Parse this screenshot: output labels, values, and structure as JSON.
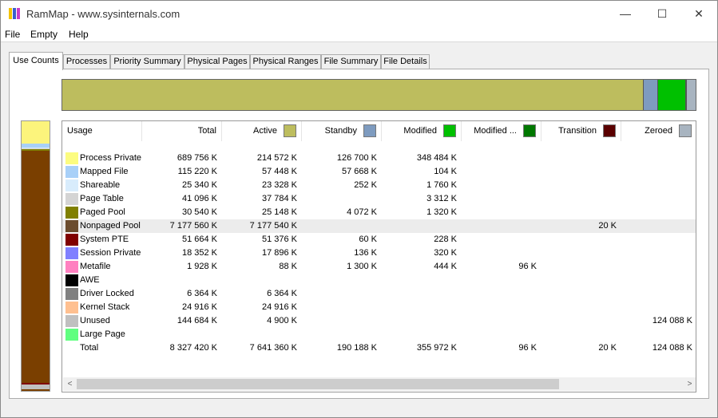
{
  "window": {
    "title": "RamMap - www.sysinternals.com",
    "icon_name": "rammap-app-icon",
    "icon_colors": [
      "#f2c200",
      "#3a5fcd",
      "#c83cc8"
    ],
    "minimize": "—",
    "maximize": "☐",
    "close": "✕"
  },
  "menu": [
    "File",
    "Empty",
    "Help"
  ],
  "tabs": [
    "Use Counts",
    "Processes",
    "Priority Summary",
    "Physical Pages",
    "Physical Ranges",
    "File Summary",
    "File Details"
  ],
  "active_tab": "Use Counts",
  "top_bar": [
    {
      "name": "Active",
      "color": "#bdbd5e",
      "fraction": 0.917
    },
    {
      "name": "Standby",
      "color": "#7e9bbf",
      "fraction": 0.023
    },
    {
      "name": "Modified",
      "color": "#00c000",
      "fraction": 0.043
    },
    {
      "name": "Modified no write",
      "color": "#007800",
      "fraction": 0.002
    },
    {
      "name": "Zeroed",
      "color": "#a8b4c0",
      "fraction": 0.015
    }
  ],
  "left_bar": [
    {
      "name": "Process Private",
      "color": "#fcf47c",
      "fraction": 0.083
    },
    {
      "name": "Mapped File",
      "color": "#a8d0f8",
      "fraction": 0.014
    },
    {
      "name": "Shareable",
      "color": "#d8ecfc",
      "fraction": 0.003
    },
    {
      "name": "Page Table",
      "color": "#d0d0d0",
      "fraction": 0.005
    },
    {
      "name": "Paged Pool",
      "color": "#808000",
      "fraction": 0.004
    },
    {
      "name": "Nonpaged Pool",
      "color": "#7a3f00",
      "fraction": 0.862
    },
    {
      "name": "System PTE",
      "color": "#800000",
      "fraction": 0.006
    },
    {
      "name": "Unused",
      "color": "#c0c0c0",
      "fraction": 0.017
    }
  ],
  "columns": [
    {
      "label": "Usage",
      "swatch": null
    },
    {
      "label": "Total",
      "swatch": null
    },
    {
      "label": "Active",
      "swatch": "#bdbd5e"
    },
    {
      "label": "Standby",
      "swatch": "#7e9bbf"
    },
    {
      "label": "Modified",
      "swatch": "#00c000"
    },
    {
      "label": "Modified ...",
      "swatch": "#007800"
    },
    {
      "label": "Transition",
      "swatch": "#5a0000"
    },
    {
      "label": "Zeroed",
      "swatch": "#a8b4c0"
    }
  ],
  "rows": [
    {
      "usage": "Process Private",
      "color": "#fcfc80",
      "cells": [
        "689 756 K",
        "214 572 K",
        "126 700 K",
        "348 484 K",
        "",
        "",
        ""
      ]
    },
    {
      "usage": "Mapped File",
      "color": "#a8d0f8",
      "cells": [
        "115 220 K",
        "57 448 K",
        "57 668 K",
        "104 K",
        "",
        "",
        ""
      ]
    },
    {
      "usage": "Shareable",
      "color": "#d8ecfc",
      "cells": [
        "25 340 K",
        "23 328 K",
        "252 K",
        "1 760 K",
        "",
        "",
        ""
      ]
    },
    {
      "usage": "Page Table",
      "color": "#d4d4d4",
      "cells": [
        "41 096 K",
        "37 784 K",
        "",
        "3 312 K",
        "",
        "",
        ""
      ]
    },
    {
      "usage": "Paged Pool",
      "color": "#808000",
      "cells": [
        "30 540 K",
        "25 148 K",
        "4 072 K",
        "1 320 K",
        "",
        "",
        ""
      ]
    },
    {
      "usage": "Nonpaged Pool",
      "color": "#6b4c2e",
      "cells": [
        "7 177 560 K",
        "7 177 540 K",
        "",
        "",
        "",
        "20 K",
        ""
      ],
      "highlight": true
    },
    {
      "usage": "System PTE",
      "color": "#800000",
      "cells": [
        "51 664 K",
        "51 376 K",
        "60 K",
        "228 K",
        "",
        "",
        ""
      ]
    },
    {
      "usage": "Session Private",
      "color": "#8080ff",
      "cells": [
        "18 352 K",
        "17 896 K",
        "136 K",
        "320 K",
        "",
        "",
        ""
      ]
    },
    {
      "usage": "Metafile",
      "color": "#ff80c0",
      "cells": [
        "1 928 K",
        "88 K",
        "1 300 K",
        "444 K",
        "96 K",
        "",
        ""
      ]
    },
    {
      "usage": "AWE",
      "color": "#000000",
      "cells": [
        "",
        "",
        "",
        "",
        "",
        "",
        ""
      ]
    },
    {
      "usage": "Driver Locked",
      "color": "#808080",
      "cells": [
        "6 364 K",
        "6 364 K",
        "",
        "",
        "",
        "",
        ""
      ]
    },
    {
      "usage": "Kernel Stack",
      "color": "#ffc090",
      "cells": [
        "24 916 K",
        "24 916 K",
        "",
        "",
        "",
        "",
        ""
      ]
    },
    {
      "usage": "Unused",
      "color": "#c0c0c0",
      "cells": [
        "144 684 K",
        "4 900 K",
        "",
        "",
        "",
        "",
        "124 088 K"
      ]
    },
    {
      "usage": "Large Page",
      "color": "#60ff80",
      "cells": [
        "",
        "",
        "",
        "",
        "",
        "",
        ""
      ]
    },
    {
      "usage": "Total",
      "color": null,
      "cells": [
        "8 327 420 K",
        "7 641 360 K",
        "190 188 K",
        "355 972 K",
        "96 K",
        "20 K",
        "124 088 K"
      ]
    }
  ],
  "scrollbar": {
    "left_arrow": "<",
    "right_arrow": ">"
  }
}
